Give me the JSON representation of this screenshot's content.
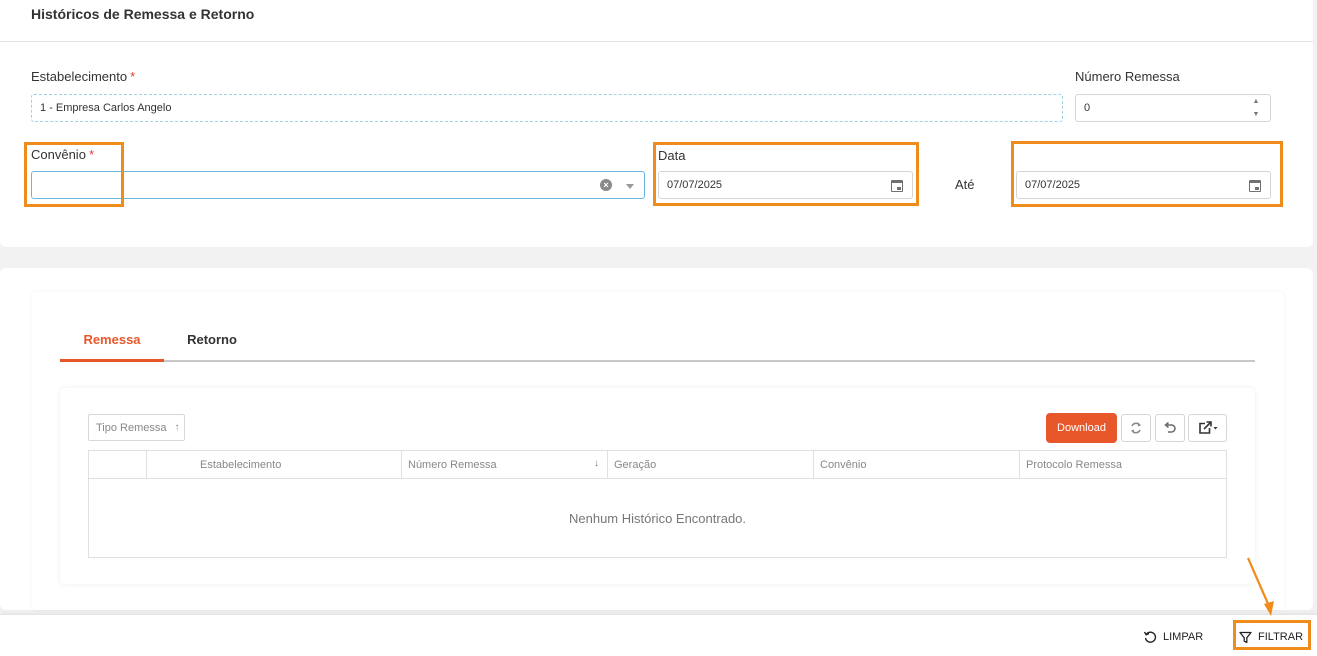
{
  "page": {
    "title": "Históricos de Remessa e Retorno"
  },
  "filters": {
    "estabelecimento": {
      "label": "Estabelecimento",
      "required_mark": "*",
      "value": "1 - Empresa Carlos Angelo"
    },
    "numero_remessa": {
      "label": "Número Remessa",
      "value": "0"
    },
    "convenio": {
      "label": "Convênio",
      "required_mark": "*",
      "value": ""
    },
    "data": {
      "label": "Data",
      "value": "07/07/2025"
    },
    "ate": {
      "label": "Até",
      "value": "07/07/2025"
    }
  },
  "tabs": [
    {
      "label": "Remessa",
      "active": true
    },
    {
      "label": "Retorno",
      "active": false
    }
  ],
  "grid": {
    "group_by": "Tipo Remessa",
    "download_label": "Download",
    "columns": [
      "Estabelecimento",
      "Número Remessa",
      "Geração",
      "Convênio",
      "Protocolo Remessa"
    ],
    "rows": [],
    "empty_message": "Nenhum Histórico Encontrado."
  },
  "footer": {
    "clear_label": "LIMPAR",
    "filter_label": "FILTRAR"
  },
  "colors": {
    "accent": "#e8572a",
    "highlight": "#f08c1c"
  }
}
